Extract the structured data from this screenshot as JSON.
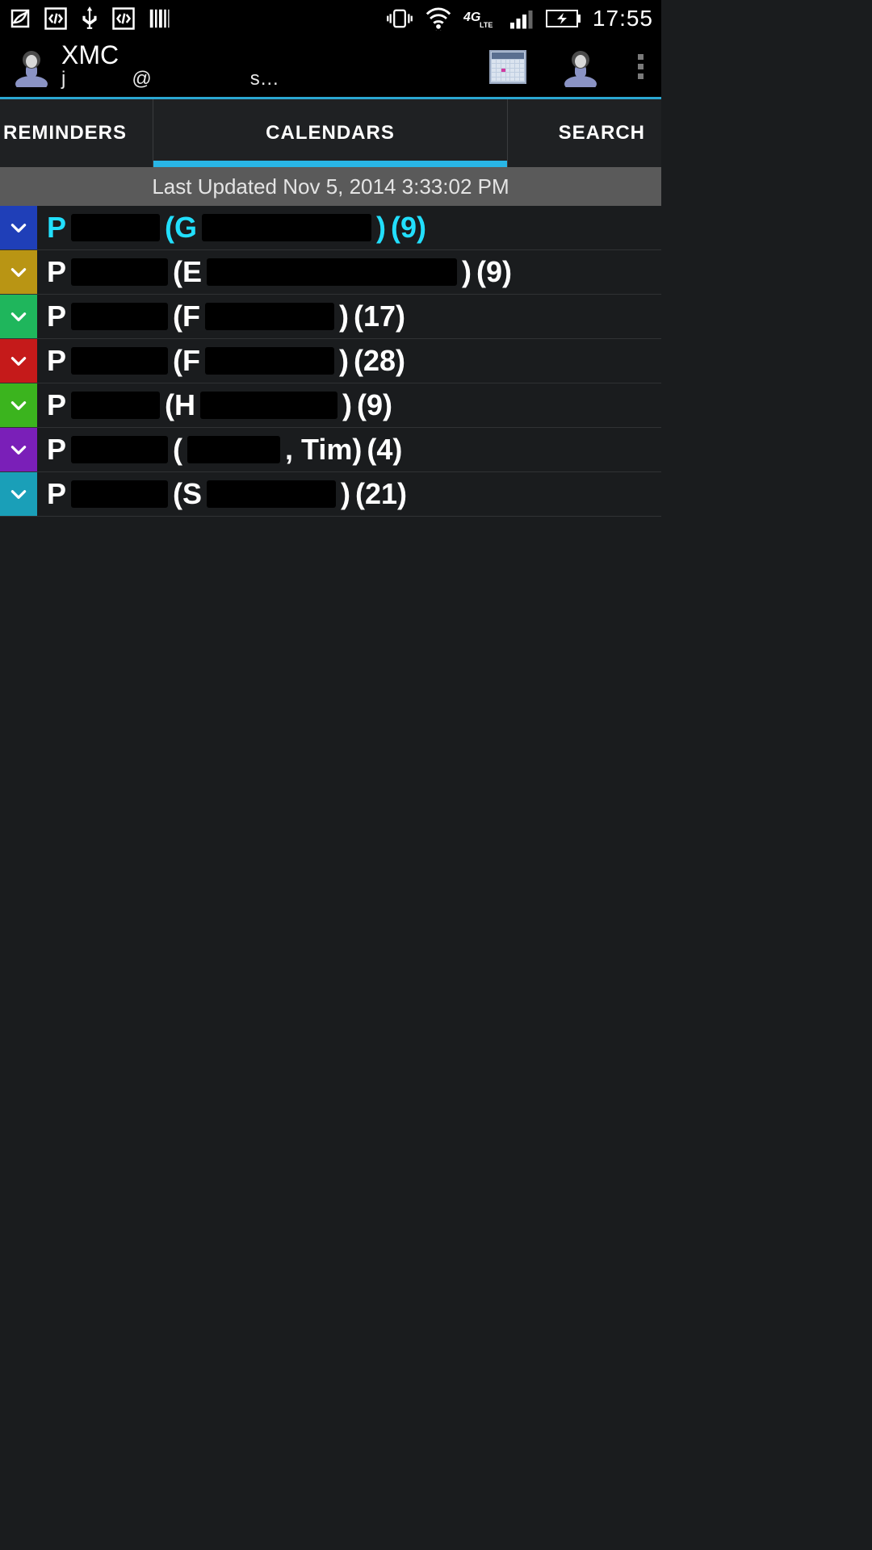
{
  "statusbar": {
    "clock": "17:55"
  },
  "actionbar": {
    "title": "XMC",
    "subtitle_prefix": "j",
    "subtitle_at": "@",
    "subtitle_suffix": "s…"
  },
  "tabs": {
    "reminders": "REMINDERS",
    "calendars": "CALENDARS",
    "search": "SEARCH"
  },
  "last_updated": "Last Updated Nov 5, 2014 3:33:02 PM",
  "calendars": [
    {
      "color": "#1f3fb8",
      "highlight": true,
      "prefix": "P",
      "paren_open": "(G",
      "paren_close": ")",
      "count": "(9)",
      "r1": 110,
      "r2": 210
    },
    {
      "color": "#b99514",
      "highlight": false,
      "prefix": "P",
      "paren_open": "(E",
      "paren_close": ")",
      "count": "(9)",
      "r1": 120,
      "r2": 310
    },
    {
      "color": "#1fb65c",
      "highlight": false,
      "prefix": "P",
      "paren_open": "(F",
      "paren_close": ")",
      "count": "(17)",
      "r1": 120,
      "r2": 160
    },
    {
      "color": "#c51a1a",
      "highlight": false,
      "prefix": "P",
      "paren_open": "(F",
      "paren_close": ")",
      "count": "(28)",
      "r1": 120,
      "r2": 160
    },
    {
      "color": "#3bb41e",
      "highlight": false,
      "prefix": "P",
      "paren_open": "(H",
      "paren_close": ")",
      "count": "(9)",
      "r1": 110,
      "r2": 170
    },
    {
      "color": "#7a1fb8",
      "highlight": false,
      "prefix": "P",
      "paren_open": "(",
      "paren_close": ", Tim)",
      "count": "(4)",
      "r1": 120,
      "r2": 115
    },
    {
      "color": "#1a9fb8",
      "highlight": false,
      "prefix": "P",
      "paren_open": "(S",
      "paren_close": ")",
      "count": "(21)",
      "r1": 120,
      "r2": 160
    }
  ]
}
